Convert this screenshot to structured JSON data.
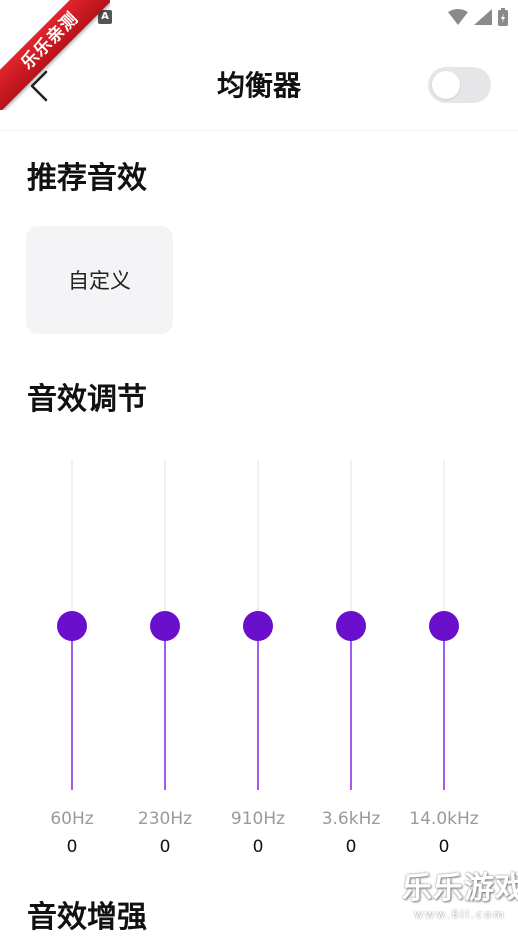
{
  "status_bar": {
    "notification_icon": "A",
    "icons": [
      "wifi-icon",
      "cell-signal-icon",
      "battery-icon"
    ]
  },
  "ribbon": {
    "text": "乐乐亲测",
    "color": "#d21d24"
  },
  "header": {
    "back_icon": "chevron-left-icon",
    "title": "均衡器",
    "toggle_on": false
  },
  "sections": {
    "recommended": "推荐音效",
    "adjust": "音效调节",
    "enhance": "音效增强"
  },
  "presets": [
    {
      "label": "自定义"
    }
  ],
  "equalizer": {
    "accent_color": "#6a0fcc",
    "fill_color": "#a25de8",
    "bands": [
      {
        "freq": "60Hz",
        "value": "0",
        "level": 0.5
      },
      {
        "freq": "230Hz",
        "value": "0",
        "level": 0.5
      },
      {
        "freq": "910Hz",
        "value": "0",
        "level": 0.5
      },
      {
        "freq": "3.6kHz",
        "value": "0",
        "level": 0.5
      },
      {
        "freq": "14.0kHz",
        "value": "0",
        "level": 0.5
      }
    ]
  },
  "watermark": {
    "text": "乐乐游戏",
    "url": "www.6ll.com"
  }
}
